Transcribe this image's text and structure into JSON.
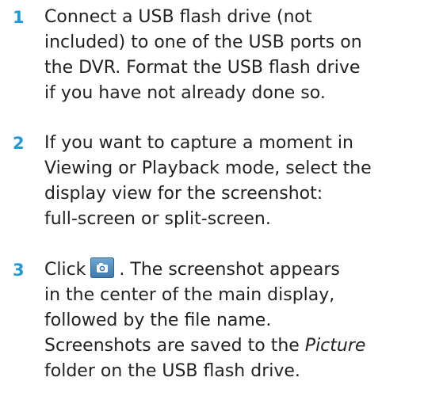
{
  "steps": [
    {
      "number": "1",
      "lines": [
        "Connect a USB flash drive (not",
        "included) to one of the USB ports on",
        "the DVR. Format the USB flash drive",
        "if you have not already done so."
      ]
    },
    {
      "number": "2",
      "lines": [
        "If you want to capture a moment in",
        "Viewing or Playback mode, select the",
        "display view for the screenshot:",
        "full-screen or split-screen."
      ]
    },
    {
      "number": "3",
      "prefix": "Click",
      "after_icon": ". The screenshot appears",
      "lines": [
        "in the center of the main display,",
        "followed by the file name.",
        "Screenshots are saved to the"
      ],
      "italic_word": "Picture",
      "last_line": "folder on the USB flash drive.",
      "icon": "camera-icon"
    }
  ],
  "colors": {
    "step_number": "#1e9ad6",
    "text": "#222222",
    "icon_background": "#4a86b8",
    "icon_glyph": "#ffffff"
  }
}
